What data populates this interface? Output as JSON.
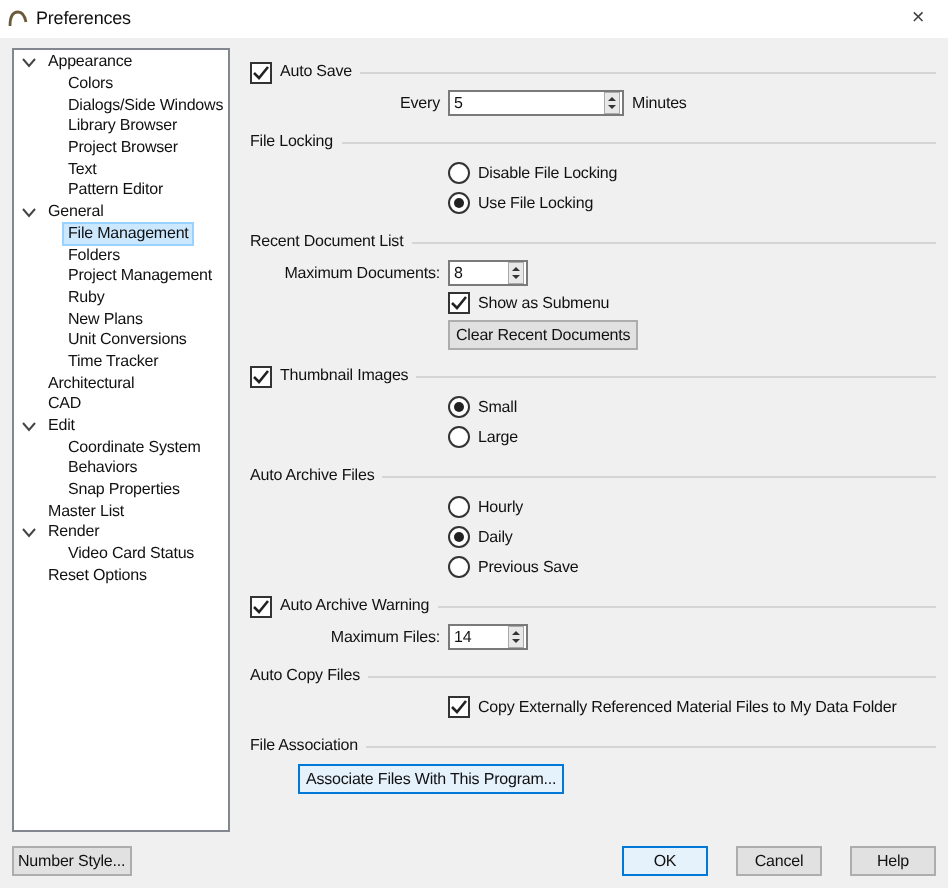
{
  "window": {
    "title": "Preferences",
    "close": "×"
  },
  "tree": [
    {
      "label": "Appearance",
      "expanded": true,
      "selected": false,
      "children": [
        {
          "label": "Colors",
          "selected": false
        },
        {
          "label": "Dialogs/Side Windows",
          "selected": false
        },
        {
          "label": "Library Browser",
          "selected": false
        },
        {
          "label": "Project Browser",
          "selected": false
        },
        {
          "label": "Text",
          "selected": false
        },
        {
          "label": "Pattern Editor",
          "selected": false
        }
      ]
    },
    {
      "label": "General",
      "expanded": true,
      "selected": false,
      "children": [
        {
          "label": "File Management",
          "selected": true
        },
        {
          "label": "Folders",
          "selected": false
        },
        {
          "label": "Project Management",
          "selected": false
        },
        {
          "label": "Ruby",
          "selected": false
        },
        {
          "label": "New Plans",
          "selected": false
        },
        {
          "label": "Unit Conversions",
          "selected": false
        },
        {
          "label": "Time Tracker",
          "selected": false
        }
      ]
    },
    {
      "label": "Architectural",
      "selected": false
    },
    {
      "label": "CAD",
      "selected": false
    },
    {
      "label": "Edit",
      "expanded": true,
      "selected": false,
      "children": [
        {
          "label": "Coordinate System",
          "selected": false
        },
        {
          "label": "Behaviors",
          "selected": false
        },
        {
          "label": "Snap Properties",
          "selected": false
        }
      ]
    },
    {
      "label": "Master List",
      "selected": false
    },
    {
      "label": "Render",
      "expanded": true,
      "selected": false,
      "children": [
        {
          "label": "Video Card Status",
          "selected": false
        }
      ]
    },
    {
      "label": "Reset Options",
      "selected": false
    }
  ],
  "rows": [
    {
      "kind": "check-header",
      "label": "Auto Save",
      "checked": true
    },
    {
      "kind": "spin",
      "label": "Every",
      "value": "5",
      "suffix": "Minutes",
      "wide": true
    },
    {
      "kind": "header",
      "label": "File Locking"
    },
    {
      "kind": "radio",
      "label": "Disable File Locking",
      "selected": false
    },
    {
      "kind": "radio",
      "label": "Use File Locking",
      "selected": true
    },
    {
      "kind": "header",
      "label": "Recent Document List"
    },
    {
      "kind": "spin",
      "label": "Maximum Documents:",
      "value": "8"
    },
    {
      "kind": "check",
      "label": "Show as Submenu",
      "checked": true
    },
    {
      "kind": "button",
      "label": "Clear Recent Documents",
      "focused": false
    },
    {
      "kind": "check-header",
      "label": "Thumbnail Images",
      "checked": true
    },
    {
      "kind": "radio",
      "label": "Small",
      "selected": true
    },
    {
      "kind": "radio",
      "label": "Large",
      "selected": false
    },
    {
      "kind": "header",
      "label": "Auto Archive Files"
    },
    {
      "kind": "radio",
      "label": "Hourly",
      "selected": false
    },
    {
      "kind": "radio",
      "label": "Daily",
      "selected": true
    },
    {
      "kind": "radio",
      "label": "Previous Save",
      "selected": false
    },
    {
      "kind": "check-header",
      "label": "Auto Archive Warning",
      "checked": true
    },
    {
      "kind": "spin",
      "label": "Maximum Files:",
      "value": "14"
    },
    {
      "kind": "header",
      "label": "Auto Copy Files"
    },
    {
      "kind": "check",
      "label": "Copy Externally Referenced Material Files to My Data Folder",
      "checked": true
    },
    {
      "kind": "header",
      "label": "File Association"
    },
    {
      "kind": "button",
      "label": "Associate Files With This Program...",
      "focused": true
    }
  ],
  "left_button": "Number Style...",
  "buttons": [
    {
      "label": "OK",
      "default": true
    },
    {
      "label": "Cancel",
      "default": false
    },
    {
      "label": "Help",
      "default": false
    }
  ]
}
